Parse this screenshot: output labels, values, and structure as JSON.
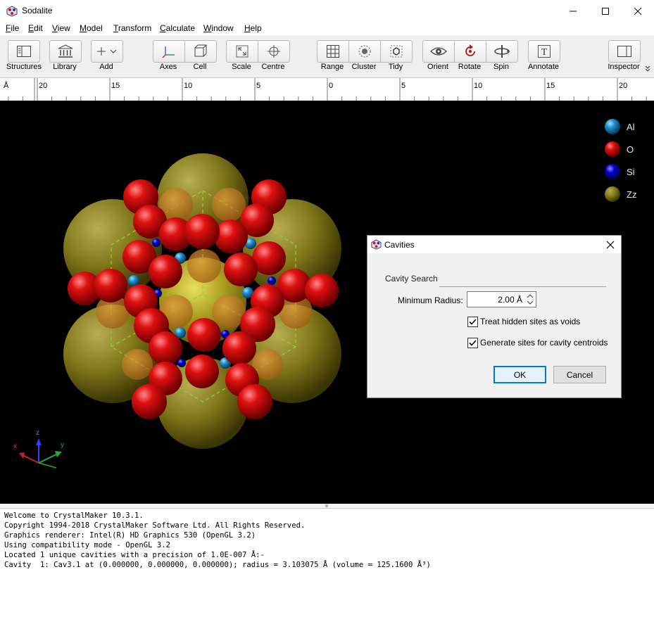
{
  "window": {
    "title": "Sodalite",
    "minimize_glyph": "—",
    "maximize_glyph": "☐",
    "close_glyph": "✕"
  },
  "menu": [
    "File",
    "Edit",
    "View",
    "Model",
    "Transform",
    "Calculate",
    "Window",
    "Help"
  ],
  "toolbar": {
    "structures": "Structures",
    "library": "Library",
    "add": "Add",
    "axes": "Axes",
    "cell": "Cell",
    "scale": "Scale",
    "centre": "Centre",
    "range": "Range",
    "cluster": "Cluster",
    "tidy": "Tidy",
    "orient": "Orient",
    "rotate": "Rotate",
    "spin": "Spin",
    "annotate": "Annotate",
    "inspector": "Inspector"
  },
  "ruler": {
    "unit": "Å",
    "labels": [
      "20",
      "15",
      "10",
      "5",
      "0",
      "5",
      "10",
      "15",
      "20"
    ]
  },
  "legend": [
    {
      "label": "Al",
      "color": "#1e8fd0"
    },
    {
      "label": "O",
      "color": "#d40000"
    },
    {
      "label": "Si",
      "color": "#0000c8"
    },
    {
      "label": "Zz",
      "color": "#a79d45"
    }
  ],
  "axes_labels": {
    "x": "x",
    "y": "y",
    "z": "z"
  },
  "dialog": {
    "title": "Cavities",
    "section": "Cavity Search",
    "min_radius_label": "Minimum Radius:",
    "min_radius_value": "2.00 Å",
    "treat_hidden_label": "Treat hidden sites as voids",
    "treat_hidden_checked": true,
    "generate_sites_label": "Generate sites for cavity centroids",
    "generate_sites_checked": true,
    "ok": "OK",
    "cancel": "Cancel"
  },
  "console": [
    "Welcome to CrystalMaker 10.3.1.",
    "Copyright 1994-2018 CrystalMaker Software Ltd. All Rights Reserved.",
    "Graphics renderer: Intel(R) HD Graphics 530 (OpenGL 3.2)",
    "Using compatibility mode - OpenGL 3.2",
    "Located 1 unique cavities with a precision of 1.0E-007 Å:-",
    "Cavity  1: Cav3.1 at (0.000000, 0.000000, 0.000000); radius = 3.103075 Å (volume = 125.1600 Å³)"
  ]
}
